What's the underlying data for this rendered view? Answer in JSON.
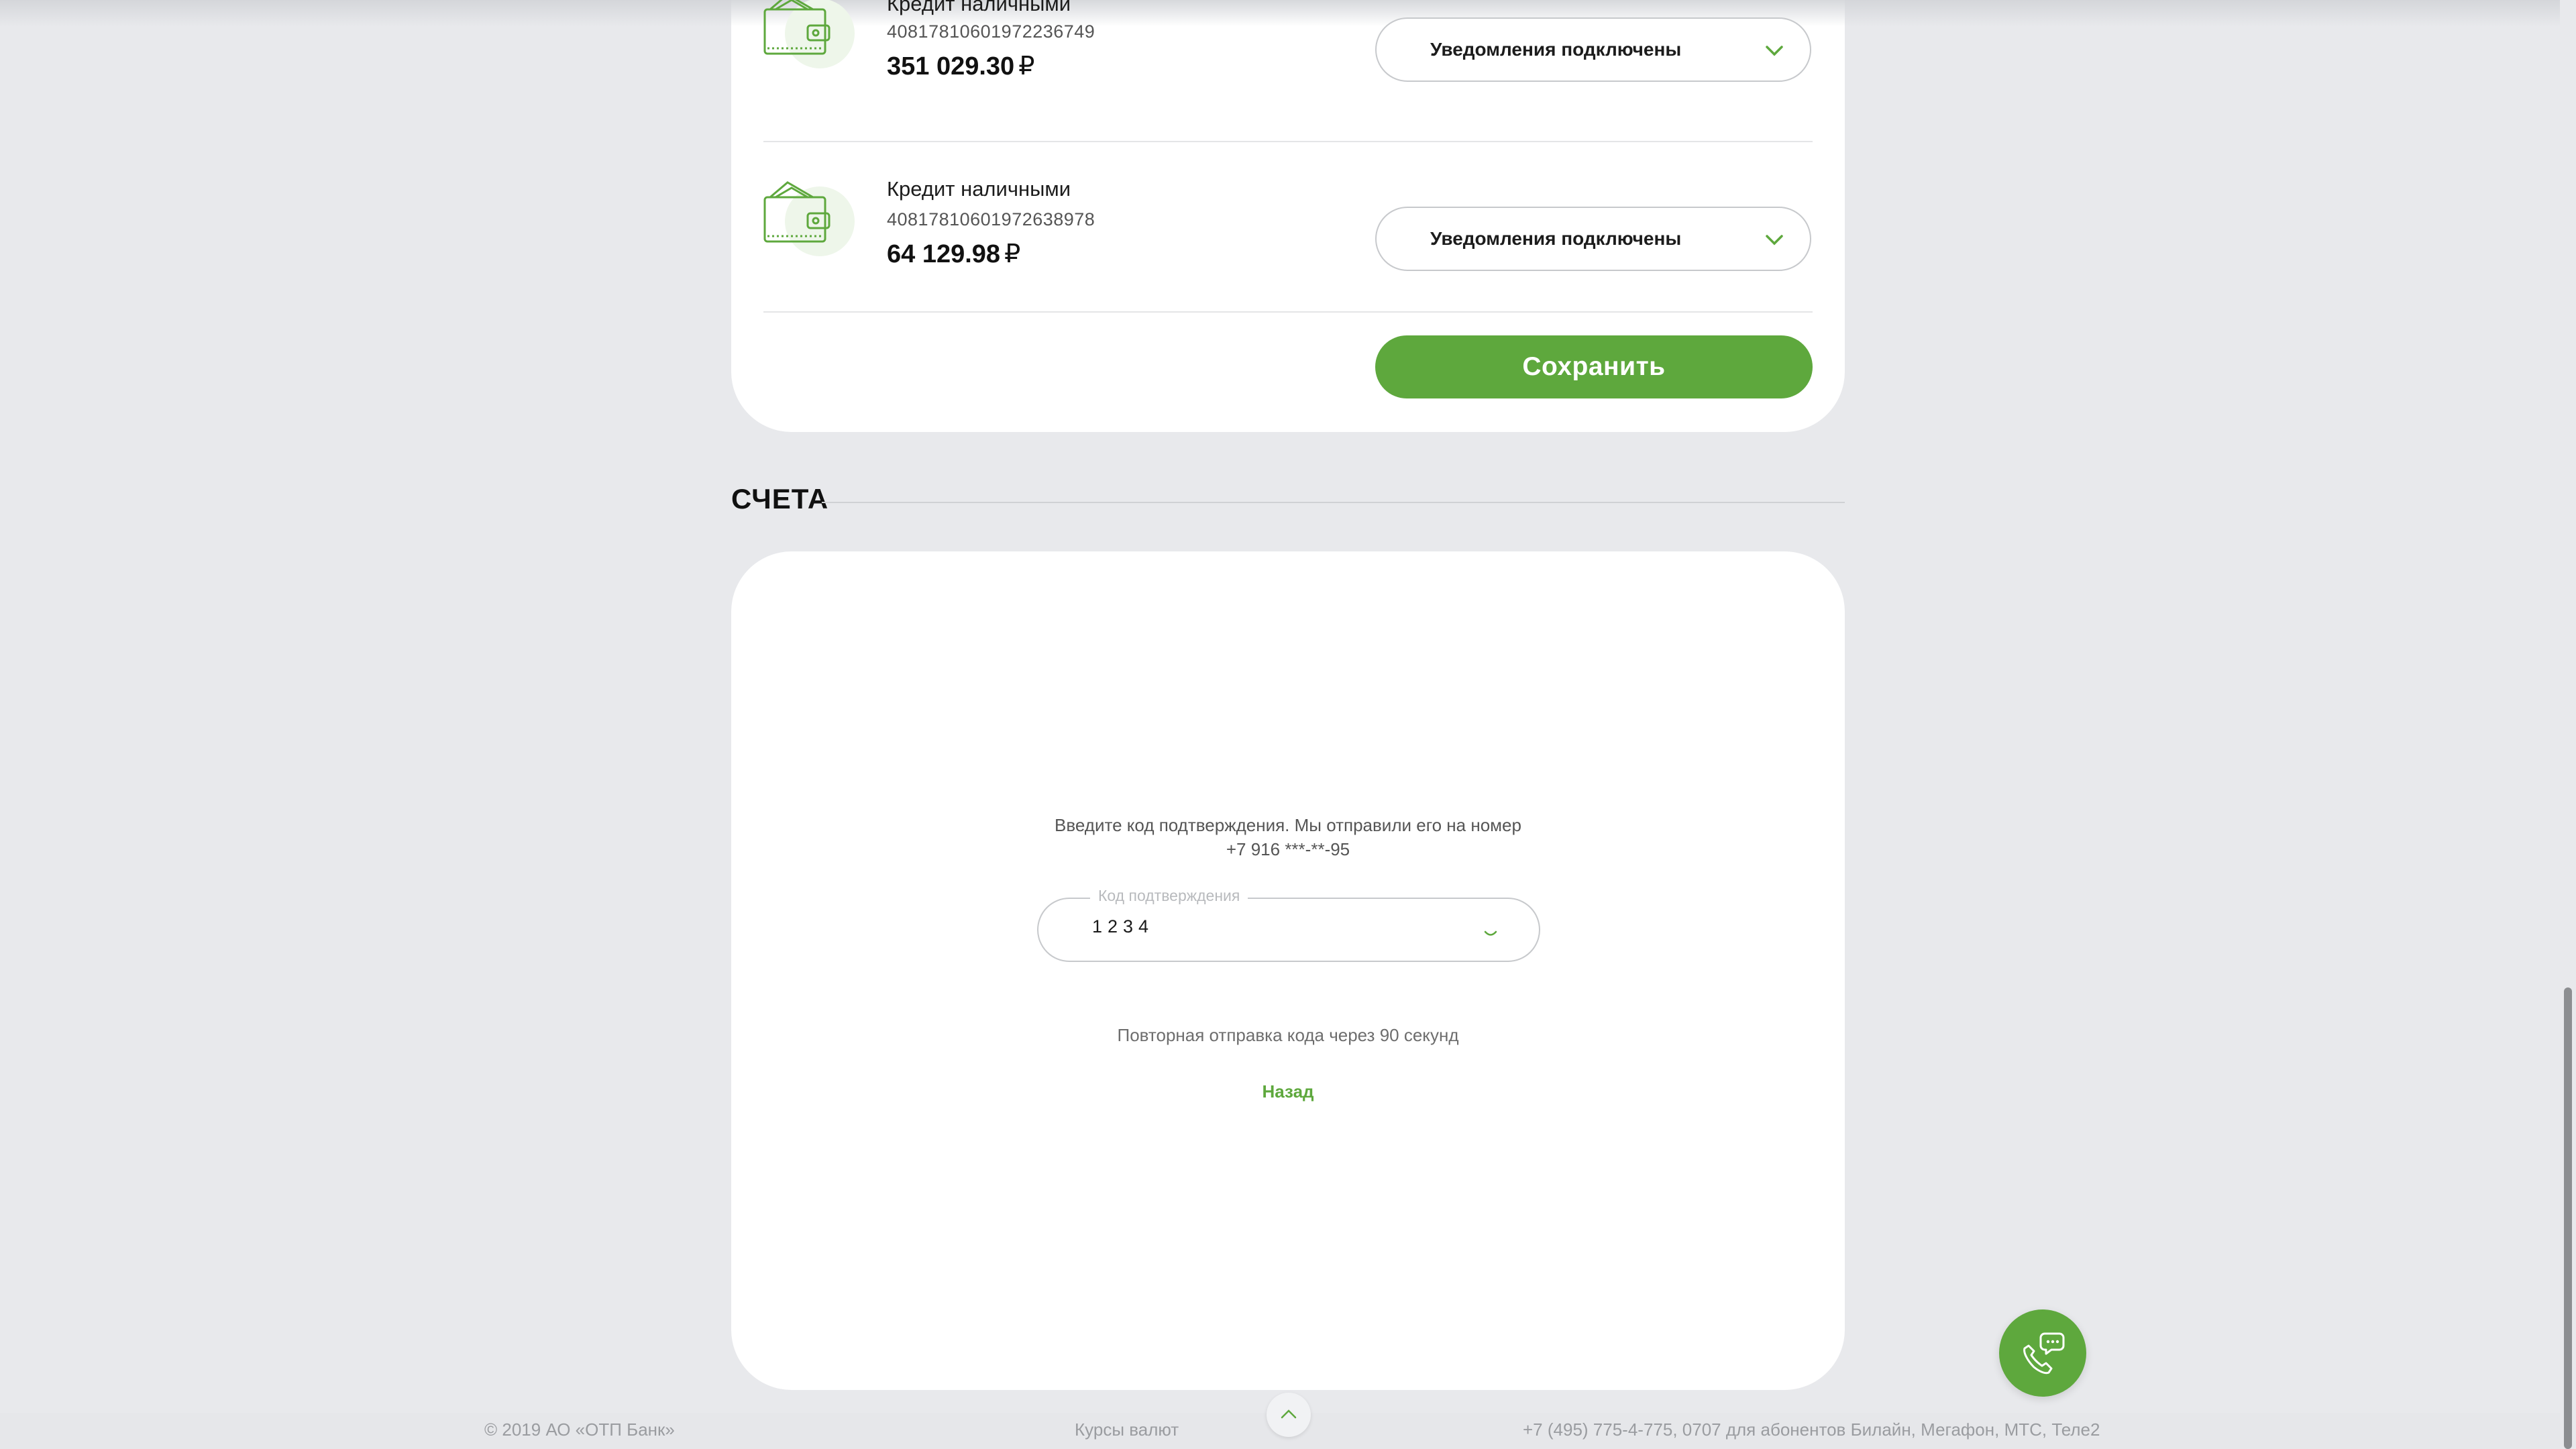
{
  "loans": [
    {
      "name": "Кредит наличными",
      "account": "40817810601972236749",
      "amount": "351 029.30",
      "currency": "₽",
      "notifications": "Уведомления подключены"
    },
    {
      "name": "Кредит наличными",
      "account": "40817810601972638978",
      "amount": "64 129.98",
      "currency": "₽",
      "notifications": "Уведомления подключены"
    }
  ],
  "save_label": "Сохранить",
  "section_title": "СЧЕТА",
  "confirm": {
    "prompt": "Введите код подтверждения. Мы отправили его на номер +7 916 ***-**-95",
    "field_label": "Код подтверждения",
    "field_value": "1234",
    "resend": "Повторная отправка кода через 90 секунд",
    "back": "Назад"
  },
  "footer": {
    "copyright": "© 2019 АО «ОТП Банк»",
    "rates": "Курсы валют",
    "phones": "+7 (495) 775-4-775,   0707 для абонентов Билайн, Мегафон, МТС, Теле2"
  },
  "colors": {
    "accent": "#5ea83d",
    "background": "#e8e9ec",
    "card": "#ffffff"
  },
  "icons": [
    "wallet-icon",
    "chevron-down-icon",
    "chevron-up-icon",
    "phone-chat-icon",
    "loading-spinner-icon"
  ]
}
